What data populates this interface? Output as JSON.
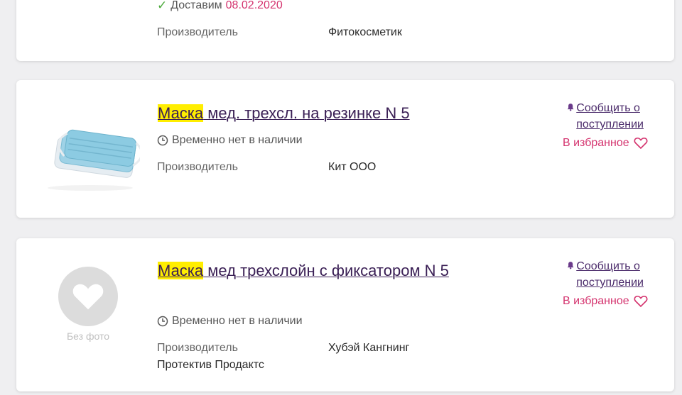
{
  "colors": {
    "accent_pink": "#d4336e",
    "link_purple": "#3a1f55",
    "highlight": "#ffee00",
    "check_green": "#4caa3c"
  },
  "products": [
    {
      "delivery_prefix": "Доставим",
      "delivery_date": "08.02.2020",
      "manufacturer_label": "Производитель",
      "manufacturer": "Фитокосметик"
    },
    {
      "title_highlight": "Маска",
      "title_rest": " мед. трехсл. на резинке N 5",
      "status": "Временно нет в наличии",
      "manufacturer_label": "Производитель",
      "manufacturer": "Кит ООО",
      "notify_label": "Сообщить о поступлении",
      "favorite_label": "В избранное",
      "image": "face-mask-photo"
    },
    {
      "title_highlight": "Маска",
      "title_rest": " мед трехслойн с фиксатором N 5",
      "status": "Временно нет в наличии",
      "manufacturer_label": "Производитель",
      "manufacturer": "Хубэй Кангнинг",
      "manufacturer_line2": "Протектив Продактс",
      "notify_label": "Сообщить о поступлении",
      "favorite_label": "В избранное",
      "no_photo_label": "Без фото"
    }
  ]
}
